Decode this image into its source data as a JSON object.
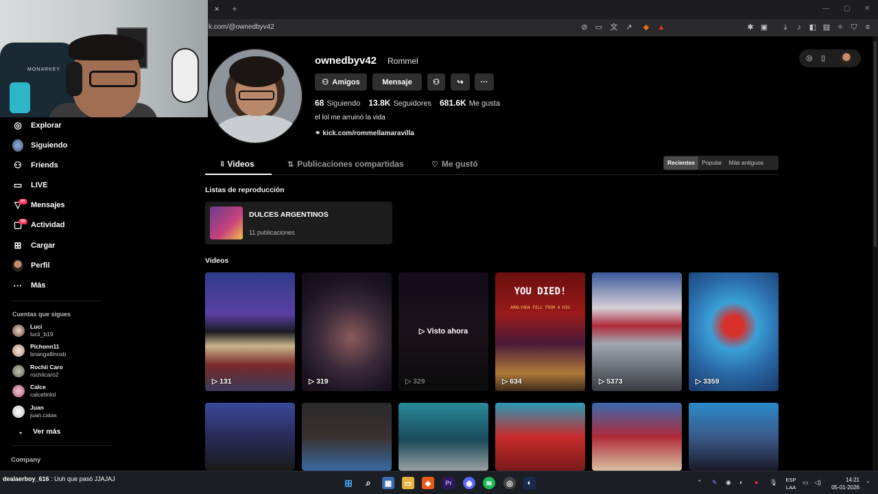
{
  "browser": {
    "url": "k.com/@ownedbyv42",
    "new_tab": "+",
    "close_tab": "×"
  },
  "sidebar": {
    "items": [
      {
        "label": "Explorar",
        "icon": "compass-icon",
        "glyph": "◎"
      },
      {
        "label": "Siguiendo",
        "icon": "avatar-icon",
        "glyph": ""
      },
      {
        "label": "Friends",
        "icon": "users-icon",
        "glyph": "⚇"
      },
      {
        "label": "LIVE",
        "icon": "live-tv-icon",
        "glyph": "▭"
      },
      {
        "label": "Mensajes",
        "icon": "message-icon",
        "glyph": "▽",
        "badge": "41"
      },
      {
        "label": "Actividad",
        "icon": "activity-icon",
        "glyph": "▢",
        "badge": "56"
      },
      {
        "label": "Cargar",
        "icon": "upload-icon",
        "glyph": "⊞"
      },
      {
        "label": "Perfil",
        "icon": "profile-avatar-icon",
        "glyph": ""
      },
      {
        "label": "Más",
        "icon": "more-icon",
        "glyph": "···"
      }
    ],
    "following_title": "Cuentas que sigues",
    "following": [
      {
        "name": "Luci",
        "user": "lucii_b19"
      },
      {
        "name": "Pichonn11",
        "user": "briangallinosb"
      },
      {
        "name": "Rochii Caro",
        "user": "rochiicaro2"
      },
      {
        "name": "Calce",
        "user": "calcetinlol"
      },
      {
        "name": "Juan",
        "user": "juan.catas"
      }
    ],
    "see_more": "Ver más",
    "company": "Company"
  },
  "profile": {
    "username": "ownedbyv42",
    "display_name": "Rommel",
    "buttons": {
      "friends": "Amigos",
      "message": "Mensaje"
    },
    "stats": {
      "following_count": "68",
      "following_label": "Siguiendo",
      "followers_count": "13.8K",
      "followers_label": "Seguidores",
      "likes_count": "681.6K",
      "likes_label": "Me gusta"
    },
    "bio": "el lol me arruinó la vida",
    "link": "kick.com/rommellamaravilla"
  },
  "tabs": {
    "videos": "Videos",
    "reposts": "Publicaciones compartidas",
    "liked": "Me gustó"
  },
  "sort": {
    "recent": "Recientes",
    "popular": "Popular",
    "oldest": "Más antiguos"
  },
  "playlists": {
    "title": "Listas de reproducción",
    "items": [
      {
        "name": "DULCES ARGENTINOS",
        "count": "11 publicaciones"
      }
    ]
  },
  "videos": {
    "title": "Videos",
    "watched_label": "Visto ahora",
    "row1": [
      "131",
      "319",
      "329",
      "634",
      "5373",
      "3359"
    ],
    "you_died": "YOU DIED!",
    "you_died_sub": "AMALYADA FELL FROM A HIG"
  },
  "taskbar": {
    "chat_user": "dealaerboy_616",
    "chat_msg": " : Uuh que pasó JJAJAJ",
    "lang_top": "ESP",
    "lang_bottom": "LAA",
    "time": "14:21",
    "date": "05-01-2026"
  }
}
